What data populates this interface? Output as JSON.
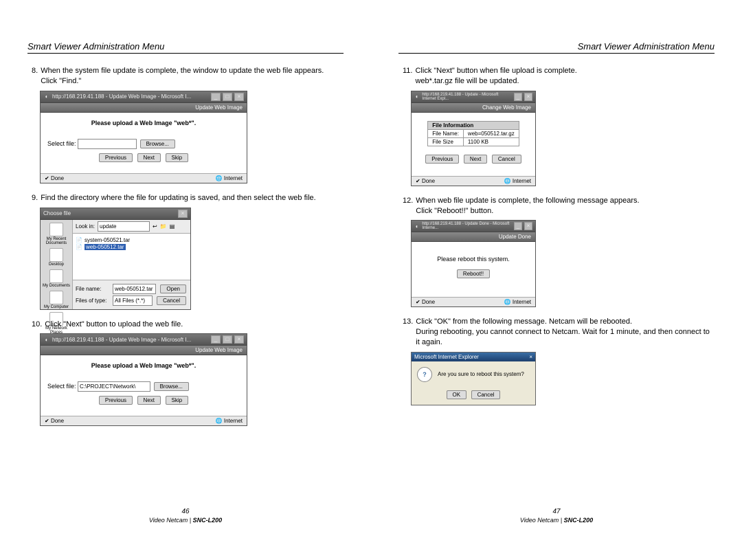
{
  "header": "Smart Viewer Administration Menu",
  "footer_model_prefix": "Video Netcam | ",
  "footer_model_bold": "SNC-L200",
  "left": {
    "page_num": "46",
    "step8_num": "8.",
    "step8_text": "When the system file update is complete, the window to update the web file appears.",
    "step8_sub": "Click \"Find.\"",
    "step9_num": "9.",
    "step9_text": "Find the directory where the file for updating is saved, and then select the web file.",
    "step10_num": "10.",
    "step10_text": "Click \"Next\" button to upload the web file."
  },
  "right": {
    "page_num": "47",
    "step11_num": "11.",
    "step11_text": "Click \"Next\" button when file upload is complete.",
    "step11_sub": "web*.tar.gz file will be updated.",
    "step12_num": "12.",
    "step12_text": "When web file update is complete, the following message appears.",
    "step12_sub": "Click \"Reboot!!\" button.",
    "step13_num": "13.",
    "step13_text": "Click \"OK\" from the following message. Netcam will be rebooted.",
    "step13_sub": "During rebooting, you cannot connect to Netcam. Wait for 1 minute, and then connect to it again."
  },
  "win_update": {
    "title": "http://168.219.41.188 - Update Web Image - Microsoft I...",
    "panel": "Update Web Image",
    "prompt": "Please upload a Web Image \"web*\".",
    "select_file": "Select file:",
    "browse": "Browse...",
    "previous": "Previous",
    "next": "Next",
    "skip": "Skip",
    "done": "Done",
    "internet": "Internet"
  },
  "win_update2_value": "C:\\PROJECT\\Network\\",
  "filedlg": {
    "title": "Choose file",
    "lookin": "Look in:",
    "folder": "update",
    "file1": "system-050521.tar",
    "file2": "web-050512.tar",
    "sidebar": [
      "My Recent Documents",
      "Desktop",
      "My Documents",
      "My Computer",
      "My Network Places"
    ],
    "filename_lbl": "File name:",
    "filename_val": "web-050512.tar",
    "filetype_lbl": "Files of type:",
    "filetype_val": "All Files (*.*)",
    "open": "Open",
    "cancel": "Cancel"
  },
  "win_change": {
    "title": "http://168.219.41.188 - Update - Microsoft Internet Expl...",
    "panel": "Change Web Image",
    "section": "File Information",
    "name_lbl": "File Name:",
    "name_val": "web=050512.tar.gz",
    "size_lbl": "File Size",
    "size_val": "1100 KB",
    "cancel": "Cancel"
  },
  "win_done": {
    "title": "http://168.219.41.188 - Update Done - Microsoft Interne...",
    "panel": "Update Done",
    "msg": "Please reboot this system.",
    "reboot": "Reboot!!"
  },
  "msgbox": {
    "title": "Microsoft Internet Explorer",
    "text": "Are you sure to reboot this system?",
    "ok": "OK",
    "cancel": "Cancel"
  }
}
